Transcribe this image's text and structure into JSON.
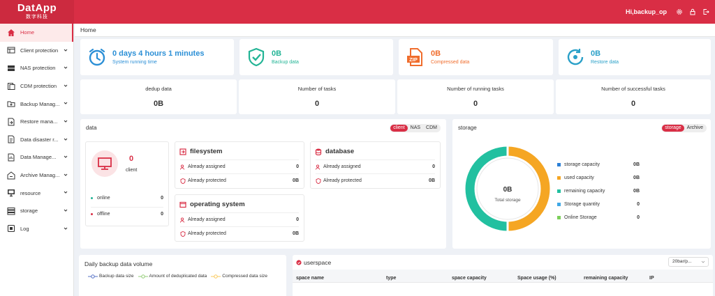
{
  "header": {
    "logo_main": "DatApp",
    "logo_sub": "数字科技",
    "user": "Hi,backup_op"
  },
  "sidebar": {
    "items": [
      {
        "label": "Home",
        "icon": "home-icon",
        "chevron": false,
        "active": true
      },
      {
        "label": "Client protection",
        "icon": "client-icon",
        "chevron": true
      },
      {
        "label": "NAS protection",
        "icon": "nas-icon",
        "chevron": true
      },
      {
        "label": "CDM protection",
        "icon": "cdm-icon",
        "chevron": true
      },
      {
        "label": "Backup Manag...",
        "icon": "backup-icon",
        "chevron": true
      },
      {
        "label": "Restore mana...",
        "icon": "restore-icon",
        "chevron": true
      },
      {
        "label": "Data disaster r...",
        "icon": "disaster-icon",
        "chevron": true
      },
      {
        "label": "Data Manage...",
        "icon": "data-manage-icon",
        "chevron": true
      },
      {
        "label": "Archive Manag...",
        "icon": "archive-icon",
        "chevron": true
      },
      {
        "label": "resource",
        "icon": "resource-icon",
        "chevron": true
      },
      {
        "label": "storage",
        "icon": "storage-icon",
        "chevron": true
      },
      {
        "label": "Log",
        "icon": "log-icon",
        "chevron": true
      }
    ]
  },
  "breadcrumb": "Home",
  "stats": [
    {
      "value": "0 days 4 hours 1 minutes",
      "label": "System running time",
      "icon": "clock-icon",
      "color": "#2b8fd6"
    },
    {
      "value": "0B",
      "label": "Backup data",
      "icon": "shield-check-icon",
      "color": "#22b495"
    },
    {
      "value": "0B",
      "label": "Compressed data",
      "icon": "zip-icon",
      "color": "#f06d2d"
    },
    {
      "value": "0B",
      "label": "Restore data",
      "icon": "restore-arrow-icon",
      "color": "#2aa0c8"
    }
  ],
  "counts": [
    {
      "label": "dedup data",
      "value": "0B"
    },
    {
      "label": "Number of tasks",
      "value": "0"
    },
    {
      "label": "Number of running tasks",
      "value": "0"
    },
    {
      "label": "Number of successful tasks",
      "value": "0"
    }
  ],
  "data_panel": {
    "title": "data",
    "tabs": [
      "client",
      "NAS",
      "CDM"
    ],
    "client": {
      "count": "0",
      "label": "client",
      "online_label": "online",
      "online": "0",
      "offline_label": "offline",
      "offline": "0"
    },
    "filesystem": {
      "title": "filesystem",
      "assigned_label": "Already assigned",
      "assigned": "0",
      "protected_label": "Already protected",
      "protected": "0B"
    },
    "database": {
      "title": "database",
      "assigned_label": "Already assigned",
      "assigned": "0",
      "protected_label": "Already protected",
      "protected": "0B"
    },
    "os": {
      "title": "operating system",
      "assigned_label": "Already assigned",
      "assigned": "0",
      "protected_label": "Already protected",
      "protected": "0B"
    }
  },
  "storage_panel": {
    "title": "storage",
    "tabs": [
      "storage",
      "Archive"
    ],
    "center_value": "0B",
    "center_label": "Total storage",
    "legend": [
      {
        "label": "storage capacity",
        "value": "0B",
        "color": "#2b7fd6"
      },
      {
        "label": "used capacity",
        "value": "0B",
        "color": "#f5a623"
      },
      {
        "label": "remaining capacity",
        "value": "0B",
        "color": "#22c0a0"
      },
      {
        "label": "Storage quantity",
        "value": "0",
        "color": "#3fa8e6"
      },
      {
        "label": "Online Storage",
        "value": "0",
        "color": "#7ccf5a"
      }
    ],
    "ring_colors": {
      "used": "#f5a623",
      "remaining": "#22c0a0"
    }
  },
  "daily_panel": {
    "title": "Daily backup data volume",
    "legend": [
      {
        "label": "Backup data size",
        "color": "#5470c6"
      },
      {
        "label": "Amount of deduplicated data",
        "color": "#91cc75"
      },
      {
        "label": "Compressed data size",
        "color": "#fac858"
      }
    ]
  },
  "userspace_panel": {
    "title": "userspace",
    "page_size": "20bar/p...",
    "columns": [
      "space name",
      "type",
      "space capacity",
      "Space usage (%)",
      "remaining capacity",
      "IP"
    ]
  }
}
